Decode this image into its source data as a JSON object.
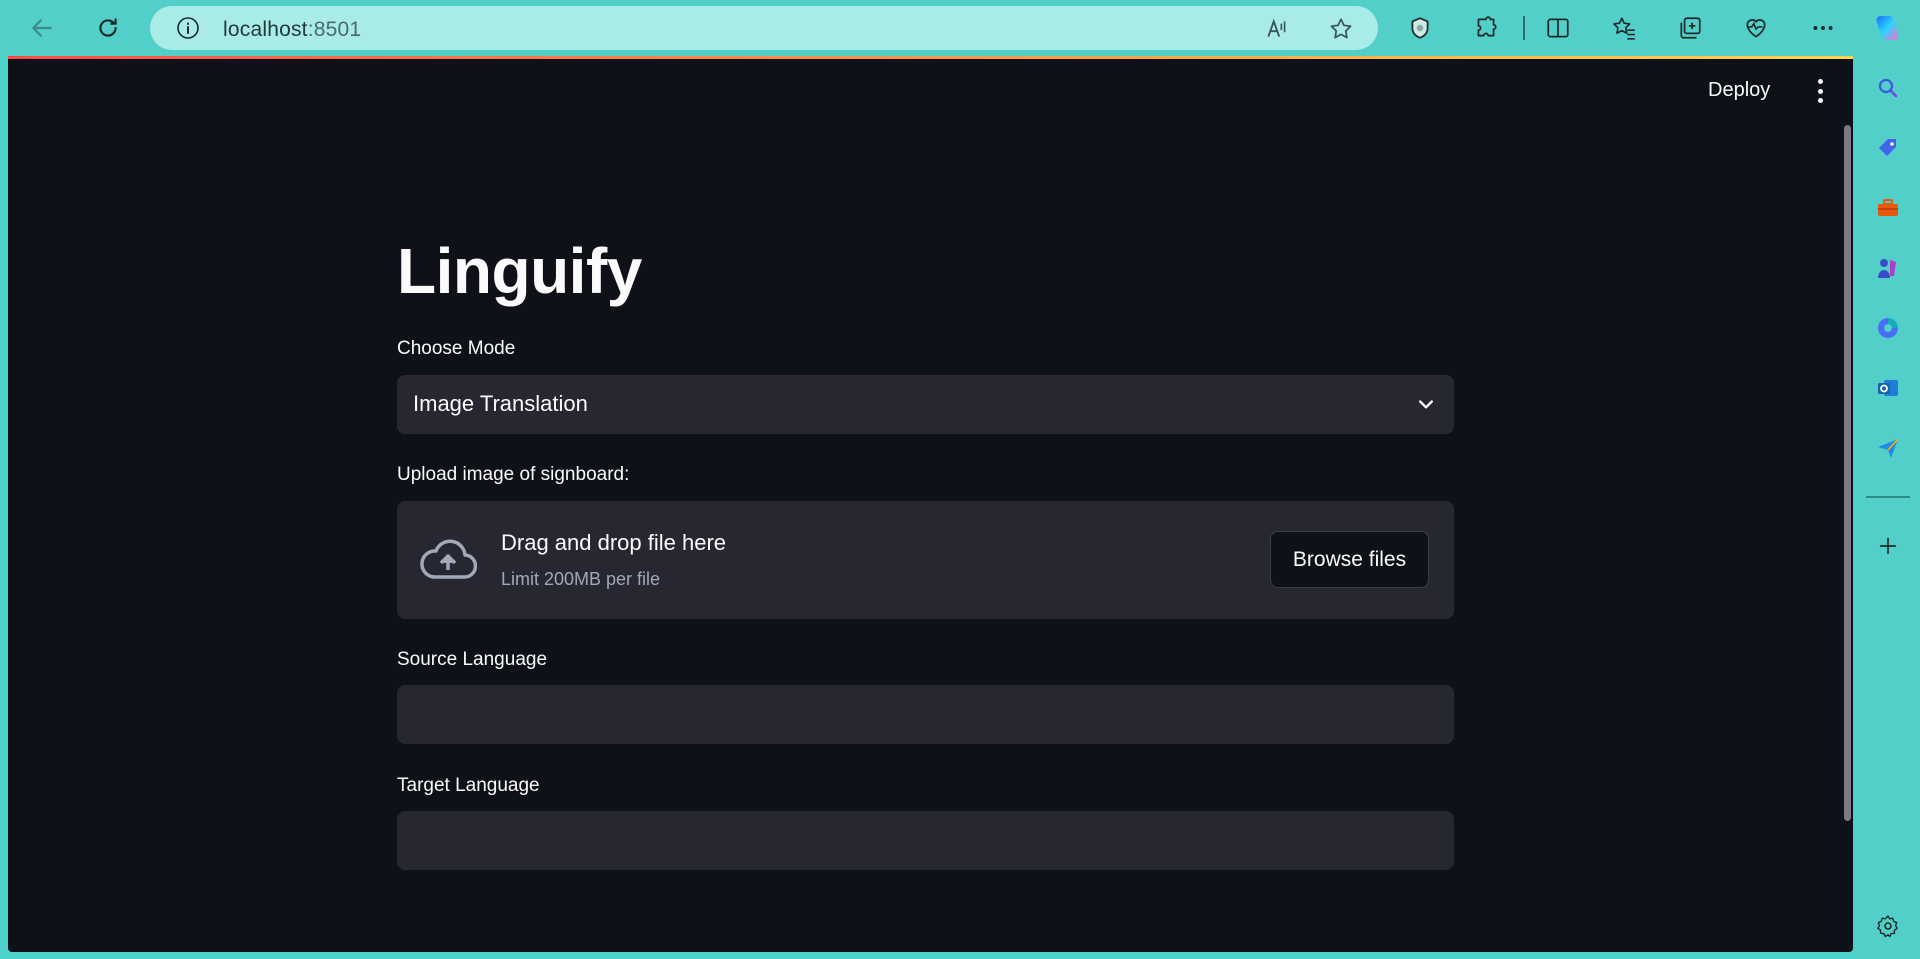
{
  "browser": {
    "url_host": "localhost",
    "url_port": ":8501"
  },
  "icons": {
    "back": "back-arrow-icon",
    "refresh": "refresh-icon",
    "site_info": "info-icon",
    "read_aloud": "read-aloud-icon",
    "favorite": "star-icon",
    "shield": "shield-icon",
    "extensions": "puzzle-icon",
    "split": "split-screen-icon",
    "favorites": "favorites-icon",
    "collections": "collections-icon",
    "health": "heart-pulse-icon",
    "more": "more-icon",
    "copilot": "copilot-icon"
  },
  "edge_sidebar": {
    "items": [
      "search-icon",
      "tag-icon",
      "toolbox-icon",
      "games-icon",
      "copilot-app-icon",
      "outlook-icon",
      "send-icon",
      "add-icon",
      "settings-icon"
    ]
  },
  "app": {
    "deploy_label": "Deploy",
    "title": "Linguify",
    "mode": {
      "label": "Choose Mode",
      "selected": "Image Translation"
    },
    "upload": {
      "label": "Upload image of signboard:",
      "drag_text": "Drag and drop file here",
      "limit_text": "Limit 200MB per file",
      "browse_label": "Browse files"
    },
    "source_language": {
      "label": "Source Language",
      "value": ""
    },
    "target_language": {
      "label": "Target Language",
      "value": ""
    }
  },
  "colors": {
    "app_bg": "#0e1117",
    "widget_bg": "#262730",
    "text": "#fafafa",
    "browser_chrome": "#52cfc9"
  }
}
